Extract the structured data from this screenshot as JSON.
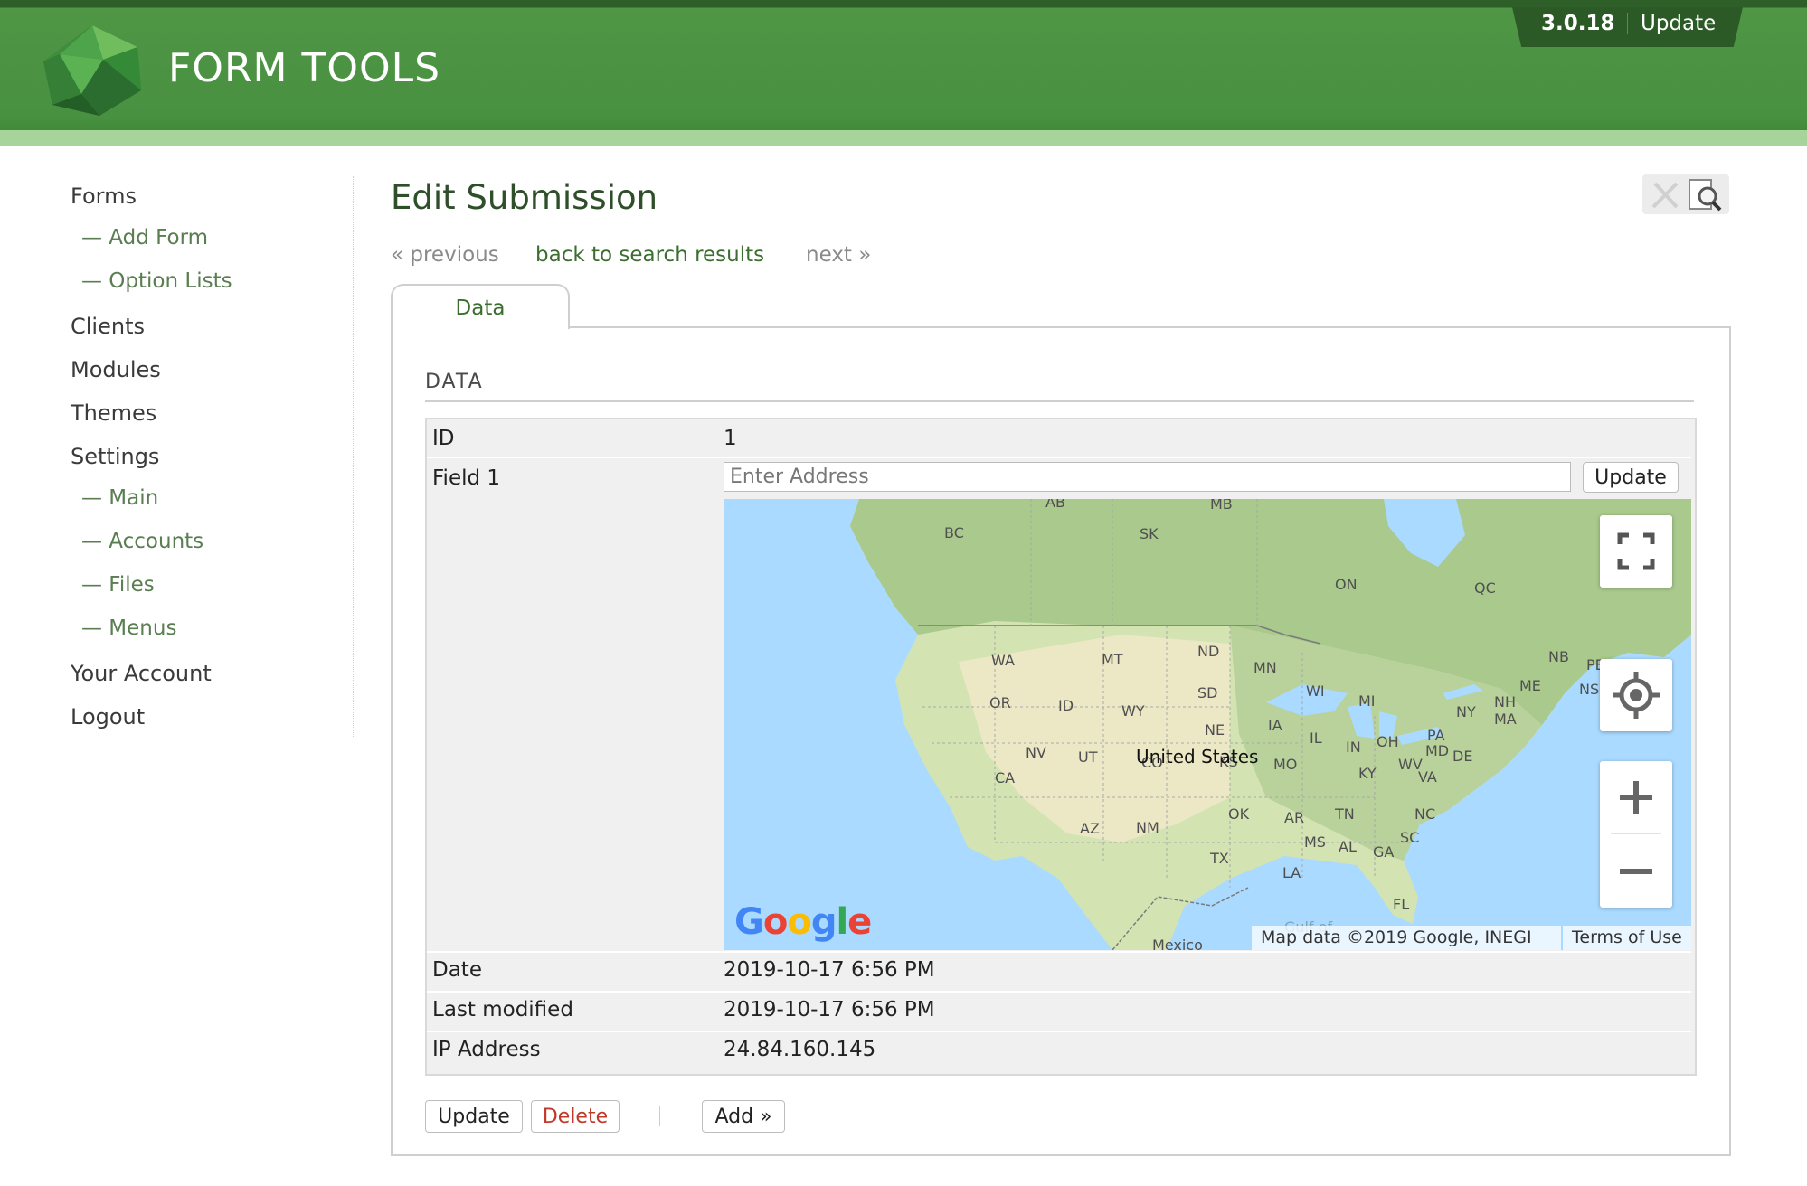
{
  "header": {
    "logo_text": "FORM TOOLS",
    "version": "3.0.18",
    "update_label": "Update"
  },
  "sidebar": {
    "items": [
      {
        "label": "Forms",
        "level": 0
      },
      {
        "label": "— Add Form",
        "level": 1
      },
      {
        "label": "— Option Lists",
        "level": 1
      },
      {
        "label": "Clients",
        "level": 0
      },
      {
        "label": "Modules",
        "level": 0
      },
      {
        "label": "Themes",
        "level": 0
      },
      {
        "label": "Settings",
        "level": 0
      },
      {
        "label": "— Main",
        "level": 1
      },
      {
        "label": "— Accounts",
        "level": 1
      },
      {
        "label": "— Files",
        "level": 1
      },
      {
        "label": "— Menus",
        "level": 1
      },
      {
        "label": "Your Account",
        "level": 0
      },
      {
        "label": "Logout",
        "level": 0
      }
    ]
  },
  "main": {
    "title": "Edit Submission",
    "pager": {
      "previous": "« previous",
      "back": "back to search results",
      "next": "next »"
    },
    "tabs": [
      {
        "label": "Data",
        "active": true
      }
    ],
    "section_heading": "DATA",
    "fields": {
      "id": {
        "label": "ID",
        "value": "1"
      },
      "field1": {
        "label": "Field 1",
        "placeholder": "Enter Address",
        "button": "Update"
      },
      "date": {
        "label": "Date",
        "value": "2019-10-17 6:56 PM"
      },
      "last_modified": {
        "label": "Last modified",
        "value": "2019-10-17 6:56 PM"
      },
      "ip": {
        "label": "IP Address",
        "value": "24.84.160.145"
      }
    },
    "map": {
      "country_label": "United States",
      "region_labels": [
        "AB",
        "MB",
        "BC",
        "SK",
        "ON",
        "QC",
        "WA",
        "MT",
        "ND",
        "MN",
        "NB",
        "PE",
        "NS",
        "ME",
        "OR",
        "ID",
        "WY",
        "SD",
        "WI",
        "MI",
        "NY",
        "NH",
        "MA",
        "IA",
        "NE",
        "IL",
        "IN",
        "OH",
        "PA",
        "MD",
        "DE",
        "NV",
        "UT",
        "CO",
        "KS",
        "MO",
        "KY",
        "WV",
        "VA",
        "CA",
        "AZ",
        "NM",
        "OK",
        "AR",
        "TN",
        "NC",
        "SC",
        "MS",
        "AL",
        "GA",
        "TX",
        "LA",
        "FL",
        "Gulf of",
        "Mexico"
      ],
      "attribution": "Map data ©2019 Google, INEGI",
      "terms": "Terms of Use",
      "logo": "Google",
      "controls": [
        "fullscreen-icon",
        "my-location-icon",
        "zoom-in-icon",
        "zoom-out-icon"
      ]
    },
    "buttons": {
      "update": "Update",
      "delete": "Delete",
      "add": "Add »"
    }
  },
  "colors": {
    "header_green": "#489141",
    "header_dark": "#2c5a26",
    "accent_link": "#3b6e2f",
    "delete_red": "#c0392b"
  }
}
